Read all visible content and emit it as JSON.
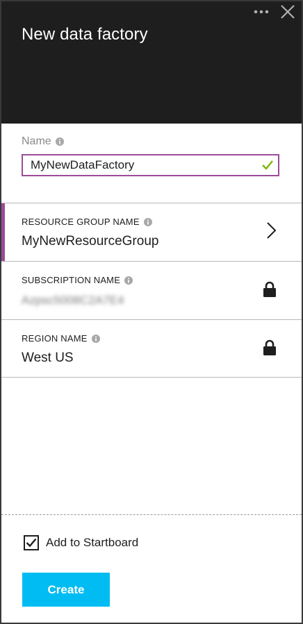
{
  "header": {
    "title": "New data factory",
    "more_icon": "ellipsis-icon",
    "close_icon": "close-icon"
  },
  "name_field": {
    "label": "Name",
    "value": "MyNewDataFactory",
    "valid": true
  },
  "resource_group": {
    "label": "RESOURCE GROUP NAME",
    "value": "MyNewResourceGroup",
    "icon": "chevron-right-icon"
  },
  "subscription": {
    "label": "SUBSCRIPTION NAME",
    "value": "Azpsc5008C2A7E4",
    "icon": "lock-icon",
    "obscured": true
  },
  "region": {
    "label": "REGION NAME",
    "value": "West US",
    "icon": "lock-icon"
  },
  "footer": {
    "startboard_label": "Add to Startboard",
    "startboard_checked": true,
    "create_label": "Create"
  },
  "colors": {
    "header_bg": "#1e1e1e",
    "accent": "#9b4b9a",
    "valid_check": "#7ab800",
    "create_button": "#00bcf2"
  }
}
